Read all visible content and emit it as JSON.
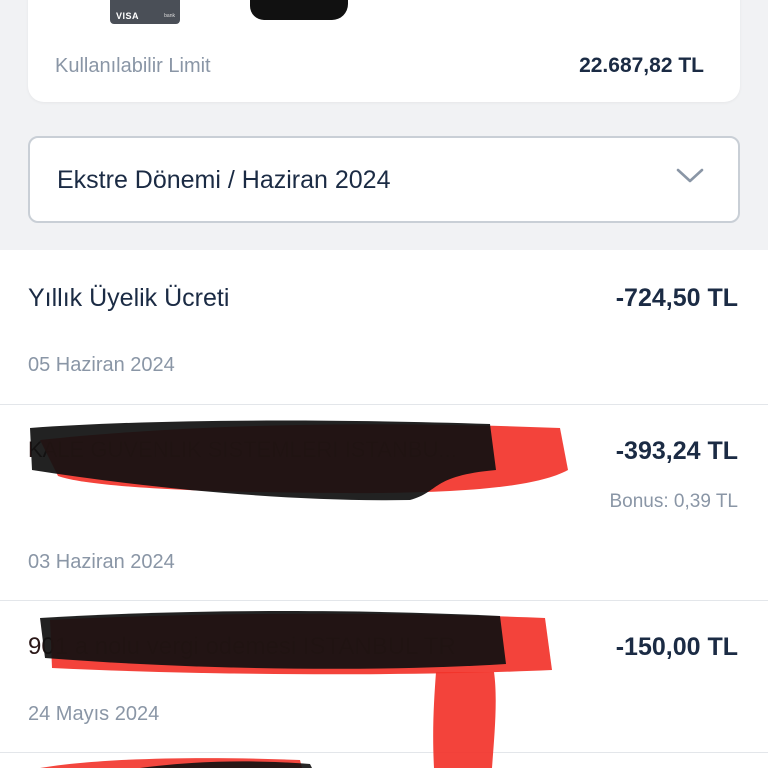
{
  "card": {
    "brand": "VISA",
    "bank_mark": "bank",
    "limit_label": "Kullanılabilir Limit",
    "limit_value": "22.687,82 TL"
  },
  "period": {
    "label": "Ekstre Dönemi / Haziran 2024",
    "icon": "chevron-down-icon"
  },
  "transactions": [
    {
      "name": "Yıllık Üyelik Ücreti",
      "amount": "-724,50 TL",
      "date": "05 Haziran 2024"
    },
    {
      "name": "KALE GUVENLIK SISTEMLERI ISTANBU...",
      "amount": "-393,24 TL",
      "bonus": "Bonus: 0,39 TL",
      "date": "03 Haziran 2024"
    },
    {
      "name": "901 a nolu vergi odemesi ISTANBUL TR",
      "amount": "-150,00 TL",
      "date": "24 Mayıs 2024"
    }
  ],
  "colors": {
    "text_primary": "#1b2b44",
    "text_secondary": "#8a96a6",
    "redact_red": "#f2332a",
    "redact_black": "#111111"
  }
}
